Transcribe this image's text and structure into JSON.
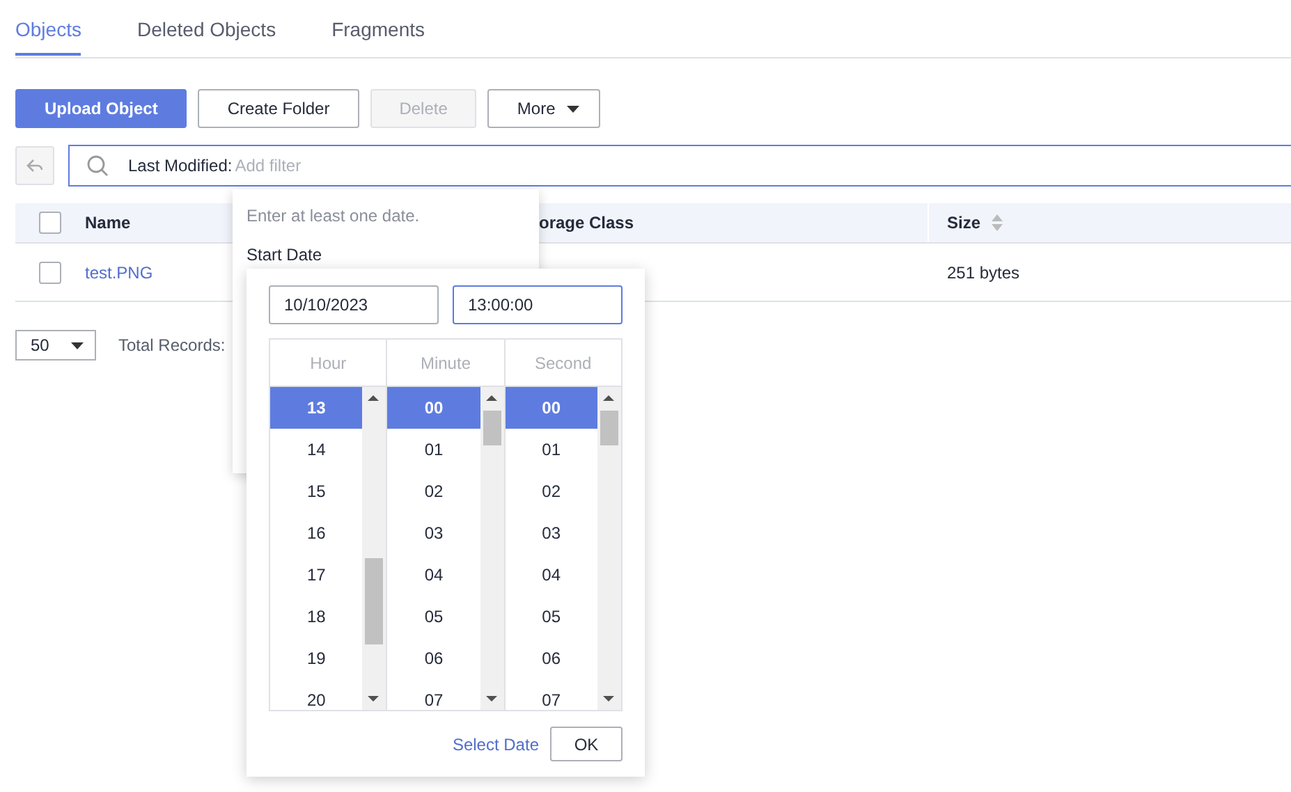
{
  "tabs": [
    {
      "label": "Objects",
      "selected": true
    },
    {
      "label": "Deleted Objects",
      "selected": false
    },
    {
      "label": "Fragments",
      "selected": false
    }
  ],
  "toolbar": [
    {
      "label": "Upload Object",
      "kind": "primary",
      "disabled": false
    },
    {
      "label": "Create Folder",
      "kind": "normal",
      "disabled": false
    },
    {
      "label": "Delete",
      "kind": "normal",
      "disabled": true
    },
    {
      "label": "More",
      "kind": "dropdown",
      "disabled": false
    }
  ],
  "search": {
    "filter_label": "Last Modified:",
    "placeholder": "Add filter"
  },
  "table": {
    "select_all_checked": false,
    "columns": [
      {
        "label": "Name",
        "sortable": false
      },
      {
        "label": "orage Class",
        "sortable": false
      },
      {
        "label": "Size",
        "sortable": true
      }
    ],
    "rows": [
      {
        "checked": false,
        "name": "test.PNG",
        "size": "251 bytes"
      }
    ]
  },
  "pagination": {
    "page_size": "50",
    "total_label": "Total Records:"
  },
  "filter_popup": {
    "hint": "Enter at least one date.",
    "field_label": "Start Date"
  },
  "picker": {
    "date": "10/10/2023",
    "time": "13:00:00",
    "columns": [
      {
        "label": "Hour",
        "items": [
          {
            "label": "13",
            "selected": true
          },
          {
            "label": "14",
            "selected": false
          },
          {
            "label": "15",
            "selected": false
          },
          {
            "label": "16",
            "selected": false
          },
          {
            "label": "17",
            "selected": false
          },
          {
            "label": "18",
            "selected": false
          },
          {
            "label": "19",
            "selected": false
          },
          {
            "label": "20",
            "selected": false
          }
        ]
      },
      {
        "label": "Minute",
        "items": [
          {
            "label": "00",
            "selected": true
          },
          {
            "label": "01",
            "selected": false
          },
          {
            "label": "02",
            "selected": false
          },
          {
            "label": "03",
            "selected": false
          },
          {
            "label": "04",
            "selected": false
          },
          {
            "label": "05",
            "selected": false
          },
          {
            "label": "06",
            "selected": false
          },
          {
            "label": "07",
            "selected": false
          }
        ]
      },
      {
        "label": "Second",
        "items": [
          {
            "label": "00",
            "selected": true
          },
          {
            "label": "01",
            "selected": false
          },
          {
            "label": "02",
            "selected": false
          },
          {
            "label": "03",
            "selected": false
          },
          {
            "label": "04",
            "selected": false
          },
          {
            "label": "05",
            "selected": false
          },
          {
            "label": "06",
            "selected": false
          },
          {
            "label": "07",
            "selected": false
          }
        ]
      }
    ],
    "link": "Select Date",
    "ok": "OK"
  }
}
